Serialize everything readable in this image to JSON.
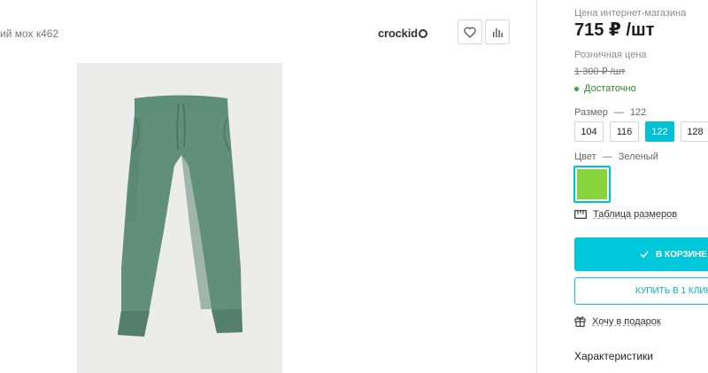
{
  "product": {
    "article_text": "ий мох к462",
    "brand": "crockid",
    "favorite_icon": "heart-icon",
    "compare_icon": "bar-chart-icon"
  },
  "pricing": {
    "online_price_label": "Цена интернет-магазина",
    "online_price": "715 ₽ /шт",
    "retail_price_label": "Розничная цена",
    "retail_price": "1 300 ₽ /шт",
    "availability": "Достаточно"
  },
  "size": {
    "label": "Размер",
    "separator": "—",
    "selected": "122",
    "options": [
      "104",
      "116",
      "122",
      "128"
    ]
  },
  "color": {
    "label": "Цвет",
    "separator": "—",
    "selected": "Зеленый",
    "swatch_hex": "#88d43b"
  },
  "actions": {
    "size_chart": "Таблица размеров",
    "cart_button": "В КОРЗИНЕ",
    "one_click_button": "КУПИТЬ В 1 КЛИК",
    "gift_link": "Хочу в подарок",
    "characteristics": "Характеристики"
  },
  "colors": {
    "accent": "#00c8db",
    "in_stock": "#38a838"
  }
}
